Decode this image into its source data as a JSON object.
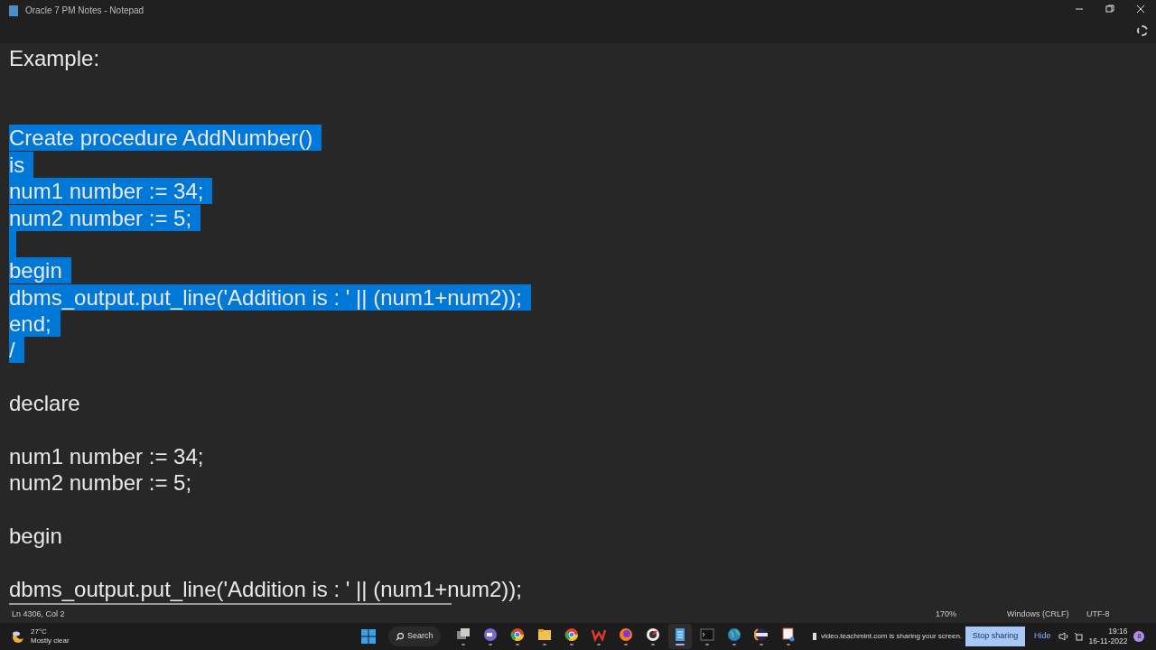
{
  "window": {
    "title": "Oracle 7 PM Notes - Notepad"
  },
  "editor": {
    "lines": [
      {
        "kind": "text",
        "text": "Example:",
        "selected": false
      },
      {
        "kind": "blank"
      },
      {
        "kind": "blank"
      },
      {
        "kind": "text",
        "text": "Create procedure AddNumber()",
        "selected": true
      },
      {
        "kind": "text",
        "text": "is",
        "selected": true
      },
      {
        "kind": "text",
        "text": "num1 number := 34;",
        "selected": true
      },
      {
        "kind": "text",
        "text": "num2 number := 5;",
        "selected": true
      },
      {
        "kind": "blank",
        "selected": true
      },
      {
        "kind": "text",
        "text": "begin",
        "selected": true
      },
      {
        "kind": "text",
        "text": "dbms_output.put_line('Addition is : ' || (num1+num2));",
        "selected": true
      },
      {
        "kind": "text",
        "text": "end;",
        "selected": true
      },
      {
        "kind": "text",
        "text": "/",
        "selected": true
      },
      {
        "kind": "blank"
      },
      {
        "kind": "text",
        "text": "declare",
        "selected": false
      },
      {
        "kind": "blank"
      },
      {
        "kind": "text",
        "text": "num1 number := 34;",
        "selected": false
      },
      {
        "kind": "text",
        "text": "num2 number := 5;",
        "selected": false
      },
      {
        "kind": "blank"
      },
      {
        "kind": "text",
        "text": "begin",
        "selected": false
      },
      {
        "kind": "blank"
      },
      {
        "kind": "text",
        "text": "dbms_output.put_line('Addition is : ' || (num1+num2));",
        "selected": false
      }
    ]
  },
  "status_bar": {
    "position": "Ln 4306, Col 2",
    "zoom": "170%",
    "line_ending": "Windows (CRLF)",
    "encoding": "UTF-8"
  },
  "taskbar": {
    "weather": {
      "temperature": "27°C",
      "condition": "Mostly clear"
    },
    "search": "Search",
    "apps": [
      {
        "kind": "taskview",
        "selected": false
      },
      {
        "kind": "chat",
        "selected": false
      },
      {
        "kind": "chrome",
        "selected": false
      },
      {
        "kind": "folder",
        "selected": false
      },
      {
        "kind": "chrome",
        "selected": false
      },
      {
        "kind": "office",
        "selected": false
      },
      {
        "kind": "firefox",
        "selected": false
      },
      {
        "kind": "gauge",
        "selected": false
      },
      {
        "kind": "notepad",
        "selected": true
      },
      {
        "kind": "terminal",
        "selected": false
      },
      {
        "kind": "globe",
        "selected": false
      },
      {
        "kind": "eclipse",
        "selected": false
      },
      {
        "kind": "snip",
        "selected": false
      }
    ],
    "sharing": {
      "message": "video.teachmint.com is sharing your screen.",
      "stop": "Stop sharing",
      "hide": "Hide"
    },
    "time": "19:16",
    "date": "16-11-2022",
    "notifications": "8"
  }
}
